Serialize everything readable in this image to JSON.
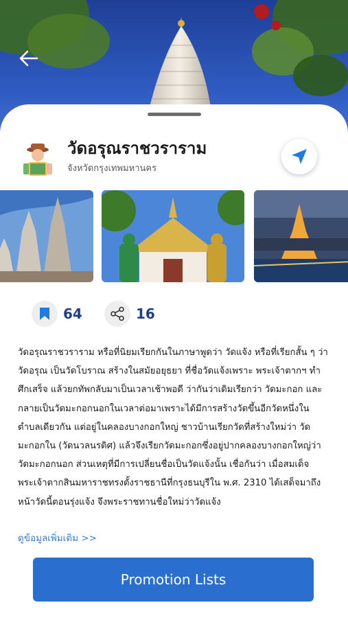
{
  "place": {
    "title": "วัดอรุณราชวราราม",
    "province": "จังหวัดกรุงเทพมหานคร"
  },
  "icons": {
    "back": "back-arrow-icon",
    "navigate": "navigation-arrow-icon",
    "bookmark": "bookmark-icon",
    "share": "share-icon",
    "avatar": "traveler-avatar-icon"
  },
  "stats": {
    "saves": "64",
    "shares": "16"
  },
  "description": "วัดอรุณราชวราราม หรือที่นิยมเรียกกันในภาษาพูดว่า วัดแจ้ง หรือที่เรียกสั้น ๆ ว่า วัดอรุณ เป็นวัดโบราณ สร้างในสมัยอยุธยา ที่ชื่อวัดแจ้งเพราะ พระเจ้าตากฯ ทำศึกเสร็จ แล้วยกทัพกลับมาเป็นเวลาเช้าพอดี ว่ากันว่าเดิมเรียกว่า วัดมะกอก และกลายเป็นวัดมะกอกนอกในเวลาต่อมาเพราะได้มีการสร้างวัดขึ้นอีกวัดหนึ่งในตำบลเดียวกัน แต่อยู่ในคลองบางกอกใหญ่ ชาวบ้านเรียกวัดที่สร้างใหม่ว่า วัดมะกอกใน (วัดนวลนรดิศ) แล้วจึงเรียกวัดมะกอกซึ่งอยู่ปากคลองบางกอกใหญ่ว่า วัดมะกอกนอก ส่วนเหตุที่มีการเปลี่ยนชื่อเป็นวัดแจ้งนั้น เชื่อกันว่า เมื่อสมเด็จพระเจ้าตากสินมหาราชทรงตั้งราชธานีที่กรุงธนบุรีใน พ.ศ. 2310 ได้เสด็จมาถึงหน้าวัดนี้ตอนรุ่งแจ้ง จึงพระราชทานชื่อใหม่ว่าวัดแจ้ง",
  "more_link": "ดูข้อมูลเพิ่มเติม >>",
  "promo_button": "Promotion Lists",
  "colors": {
    "accent": "#2a6ed0",
    "stat_number": "#1f3f8a",
    "link": "#2f7fd6",
    "navigate_arrow": "#1e7be0"
  }
}
